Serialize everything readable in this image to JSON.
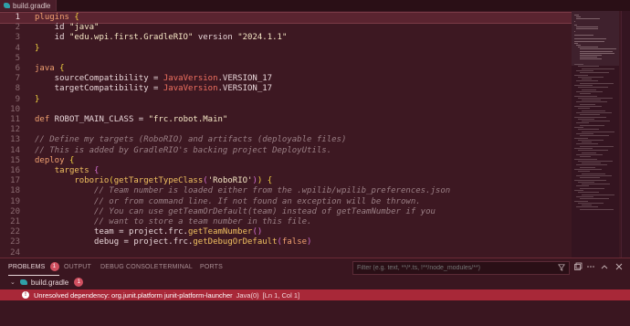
{
  "tab": {
    "title": "build.gradle"
  },
  "editor": {
    "lines": [
      {
        "n": "1",
        "html": "<span class='kw'>plugins</span> <span class='br'>{</span>",
        "current": true
      },
      {
        "n": "2",
        "html": "    id <span class='str'>\"java\"</span>"
      },
      {
        "n": "3",
        "html": "    id <span class='str'>\"edu.wpi.first.GradleRIO\"</span> version <span class='str'>\"2024.1.1\"</span>"
      },
      {
        "n": "4",
        "html": "<span class='br'>}</span>"
      },
      {
        "n": "5",
        "html": ""
      },
      {
        "n": "6",
        "html": "<span class='kw'>java</span> <span class='br'>{</span>"
      },
      {
        "n": "7",
        "html": "    sourceCompatibility = <span class='cls'>JavaVersion</span>.VERSION_17"
      },
      {
        "n": "8",
        "html": "    targetCompatibility = <span class='cls'>JavaVersion</span>.VERSION_17"
      },
      {
        "n": "9",
        "html": "<span class='br'>}</span>"
      },
      {
        "n": "10",
        "html": ""
      },
      {
        "n": "11",
        "html": "<span class='kw'>def</span> ROBOT_MAIN_CLASS = <span class='str'>\"frc.robot.Main\"</span>"
      },
      {
        "n": "12",
        "html": ""
      },
      {
        "n": "13",
        "html": "<span class='cmt'>// Define my targets (RoboRIO) and artifacts (deployable files)</span>"
      },
      {
        "n": "14",
        "html": "<span class='cmt'>// This is added by GradleRIO's backing project DeployUtils.</span>"
      },
      {
        "n": "15",
        "html": "<span class='kw'>deploy</span> <span class='br'>{</span>"
      },
      {
        "n": "16",
        "html": "    <span class='fn'>targets</span> <span class='br2'>{</span>"
      },
      {
        "n": "17",
        "html": "        <span class='fn'>roborio</span><span class='br'>(</span><span class='fn'>getTargetTypeClass</span><span class='br2'>(</span><span class='str'>'RoboRIO'</span><span class='br2'>)</span><span class='br'>)</span> <span class='br'>{</span>"
      },
      {
        "n": "18",
        "html": "            <span class='cmt'>// Team number is loaded either from the .wpilib/wpilib_preferences.json</span>"
      },
      {
        "n": "19",
        "html": "            <span class='cmt'>// or from command line. If not found an exception will be thrown.</span>"
      },
      {
        "n": "20",
        "html": "            <span class='cmt'>// You can use getTeamOrDefault(team) instead of getTeamNumber if you</span>"
      },
      {
        "n": "21",
        "html": "            <span class='cmt'>// want to store a team number in this file.</span>"
      },
      {
        "n": "22",
        "html": "            team = project.frc.<span class='fn'>getTeamNumber</span><span class='br2'>()</span>"
      },
      {
        "n": "23",
        "html": "            debug = project.frc.<span class='fn'>getDebugOrDefault</span><span class='br2'>(</span><span class='kw'>false</span><span class='br2'>)</span>"
      },
      {
        "n": "24",
        "html": ""
      }
    ]
  },
  "panel": {
    "tabs": {
      "problems": "PROBLEMS",
      "problems_count": "1",
      "output": "OUTPUT",
      "debug_console": "DEBUG CONSOLE",
      "terminal": "TERMINAL",
      "ports": "PORTS"
    },
    "filter": {
      "placeholder": "Filter (e.g. text, **/*.ts, !**/node_modules/**)"
    },
    "file": {
      "name": "build.gradle",
      "count": "1"
    },
    "error": {
      "message": "Unresolved dependency: org.junit.platform junit-platform-launcher",
      "source": "Java(0)",
      "location": "[Ln 1, Col 1]"
    }
  },
  "colors": {
    "background": "#3d1822",
    "error_row": "#a82838",
    "badge": "#d05060"
  }
}
